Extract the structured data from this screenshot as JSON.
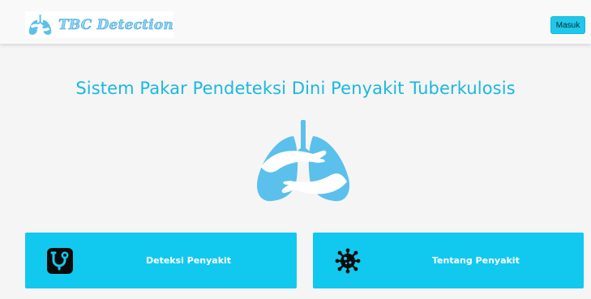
{
  "navbar": {
    "brand_name": "TBC Detection",
    "brand_logo_icon": "lungs-hug-icon",
    "login_label": "Masuk"
  },
  "main": {
    "headline": "Sistem Pakar Pendeteksi Dini Penyakit Tuberkulosis",
    "hero_icon": "lungs-hug-illustration"
  },
  "cards": [
    {
      "label": "Deteksi Penyakit",
      "icon": "stethoscope-icon"
    },
    {
      "label": "Tentang Penyakit",
      "icon": "virus-icon"
    }
  ],
  "colors": {
    "accent": "#11c9ef",
    "headline": "#1ab8e0",
    "lungs": "#5bc0eb",
    "background": "#f5f5f5"
  }
}
